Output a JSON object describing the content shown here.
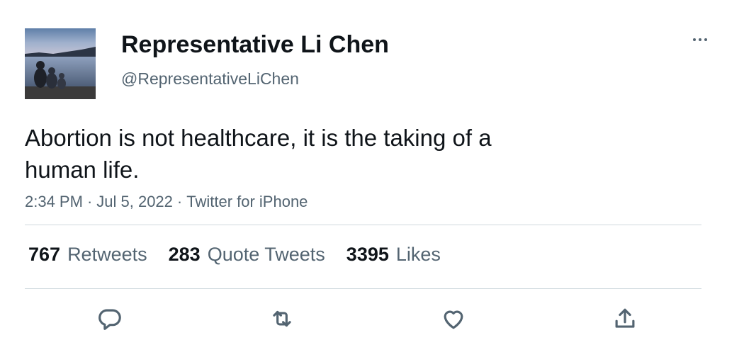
{
  "author": {
    "name": "Representative Li Chen",
    "handle": "@RepresentativeLiChen"
  },
  "tweet": {
    "text": "Abortion is not healthcare, it is the taking of a human life.",
    "time": "2:34 PM",
    "date": "Jul 5, 2022",
    "source": "Twitter for iPhone",
    "separator": "·"
  },
  "stats": {
    "retweets": {
      "value": "767",
      "label": "Retweets"
    },
    "quote_tweets": {
      "value": "283",
      "label": "Quote Tweets"
    },
    "likes": {
      "value": "3395",
      "label": "Likes"
    }
  },
  "icons": {
    "more": "more-options-icon",
    "reply": "reply-icon",
    "retweet": "retweet-icon",
    "like": "like-icon",
    "share": "share-icon"
  },
  "colors": {
    "text_primary": "#0f1419",
    "text_secondary": "#536471",
    "divider": "#cfd9de"
  }
}
